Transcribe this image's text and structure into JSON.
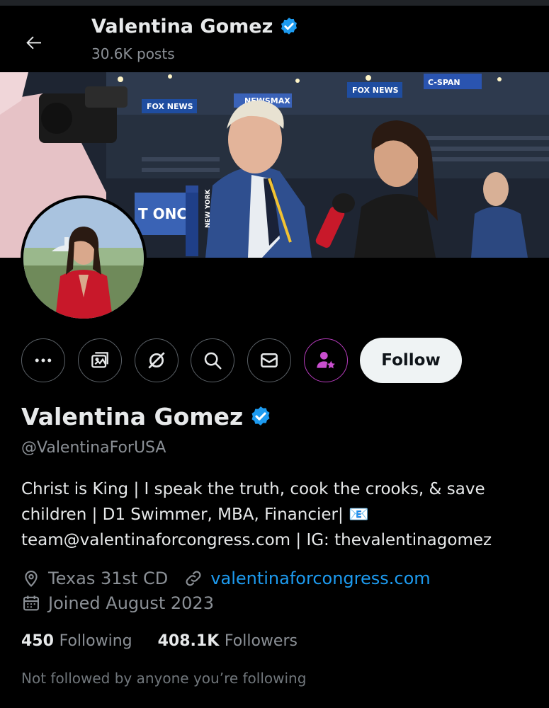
{
  "header": {
    "back_icon": "arrow-left-icon",
    "name": "Valentina Gomez",
    "posts": "30.6K posts"
  },
  "banner": {
    "signs": [
      "FOX NEWS",
      "FOX NEWS",
      "NEWSMAX",
      "FOX NEWS",
      "C-SPAN",
      "T ONC",
      "NEW YORK"
    ]
  },
  "actions": {
    "more_icon": "more-dots-icon",
    "media_icon": "media-icon",
    "grok_icon": "grok-icon",
    "search_icon": "search-icon",
    "message_icon": "mail-icon",
    "subscribe_icon": "subscribe-star-icon",
    "follow_label": "Follow"
  },
  "profile": {
    "name": "Valentina Gomez",
    "handle": "@ValentinaForUSA",
    "bio_lines": [
      "Christ is King | I speak the truth, cook the crooks, & save",
      "children | D1 Swimmer, MBA, Financier| 📧",
      "team@valentinaforcongress.com | IG: thevalentinagomez"
    ],
    "location": "Texas 31st CD",
    "website": "valentinaforcongress.com",
    "joined": "Joined August 2023",
    "following_count": "450",
    "following_label": "Following",
    "followers_count": "408.1K",
    "followers_label": "Followers",
    "mutuals_note": "Not followed by anyone you’re following"
  },
  "colors": {
    "background": "#000000",
    "verified": "#1d9bf0",
    "link": "#1d9bf0",
    "subscribe": "#b73bbd",
    "follow_button": "#eff3f4"
  }
}
